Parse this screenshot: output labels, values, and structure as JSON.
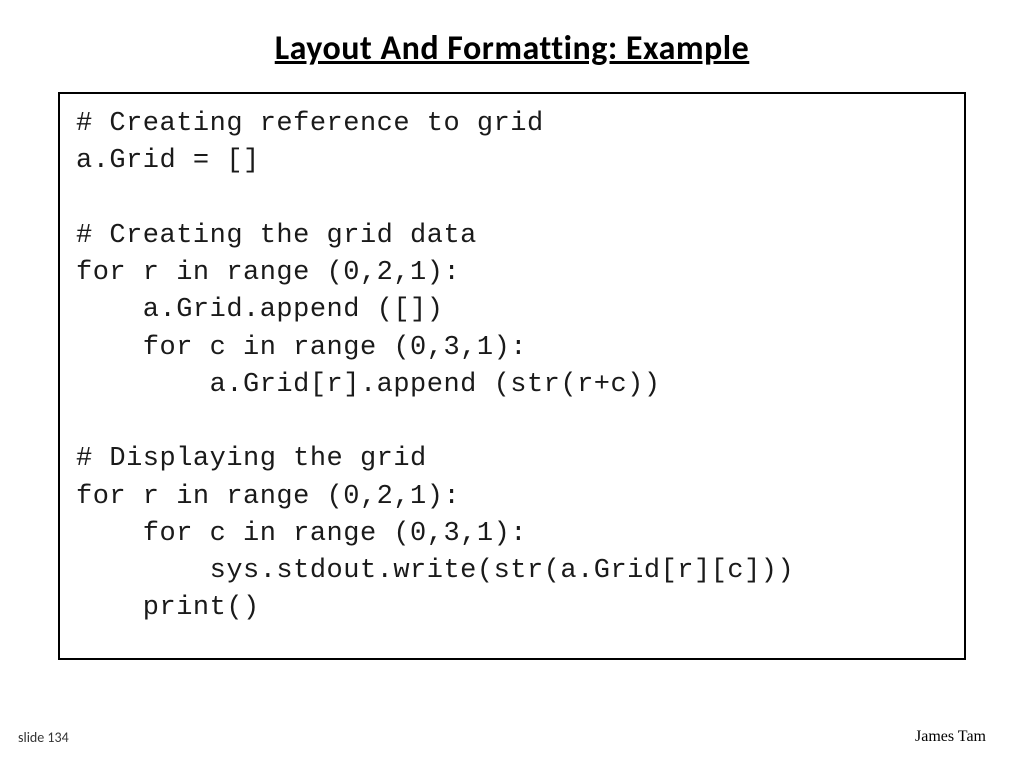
{
  "slide": {
    "title": "Layout And Formatting: Example",
    "footer_left": "slide 134",
    "footer_right": "James Tam"
  },
  "code": {
    "lines": [
      "# Creating reference to grid",
      "a.Grid = []",
      "",
      "# Creating the grid data",
      "for r in range (0,2,1):",
      "    a.Grid.append ([])",
      "    for c in range (0,3,1):",
      "        a.Grid[r].append (str(r+c))",
      "",
      "# Displaying the grid",
      "for r in range (0,2,1):",
      "    for c in range (0,3,1):",
      "        sys.stdout.write(str(a.Grid[r][c]))",
      "    print()"
    ]
  }
}
